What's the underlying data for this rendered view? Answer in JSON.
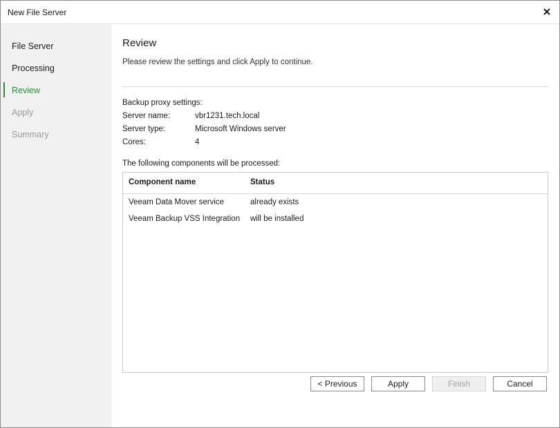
{
  "window": {
    "title": "New File Server",
    "close_icon": "close-icon"
  },
  "steps": [
    {
      "label": "File Server",
      "state": "done"
    },
    {
      "label": "Processing",
      "state": "done"
    },
    {
      "label": "Review",
      "state": "active"
    },
    {
      "label": "Apply",
      "state": "disabled"
    },
    {
      "label": "Summary",
      "state": "disabled"
    }
  ],
  "page": {
    "title": "Review",
    "description": "Please review the settings and click Apply to continue."
  },
  "proxy": {
    "header": "Backup proxy settings:",
    "fields": [
      {
        "label": "Server name:",
        "value": "vbr1231.tech.local"
      },
      {
        "label": "Server type:",
        "value": "Microsoft Windows server"
      },
      {
        "label": "Cores:",
        "value": "4"
      }
    ]
  },
  "components": {
    "header": "The following components will be processed:",
    "columns": [
      "Component name",
      "Status"
    ],
    "rows": [
      {
        "name": "Veeam Data Mover service",
        "status": "already exists"
      },
      {
        "name": "Veeam Backup VSS Integration",
        "status": "will be installed"
      }
    ]
  },
  "buttons": {
    "previous": "< Previous",
    "apply": "Apply",
    "finish": "Finish",
    "cancel": "Cancel"
  },
  "colors": {
    "accent": "#2d8a3a",
    "sidebar_bg": "#f1f1f1"
  }
}
